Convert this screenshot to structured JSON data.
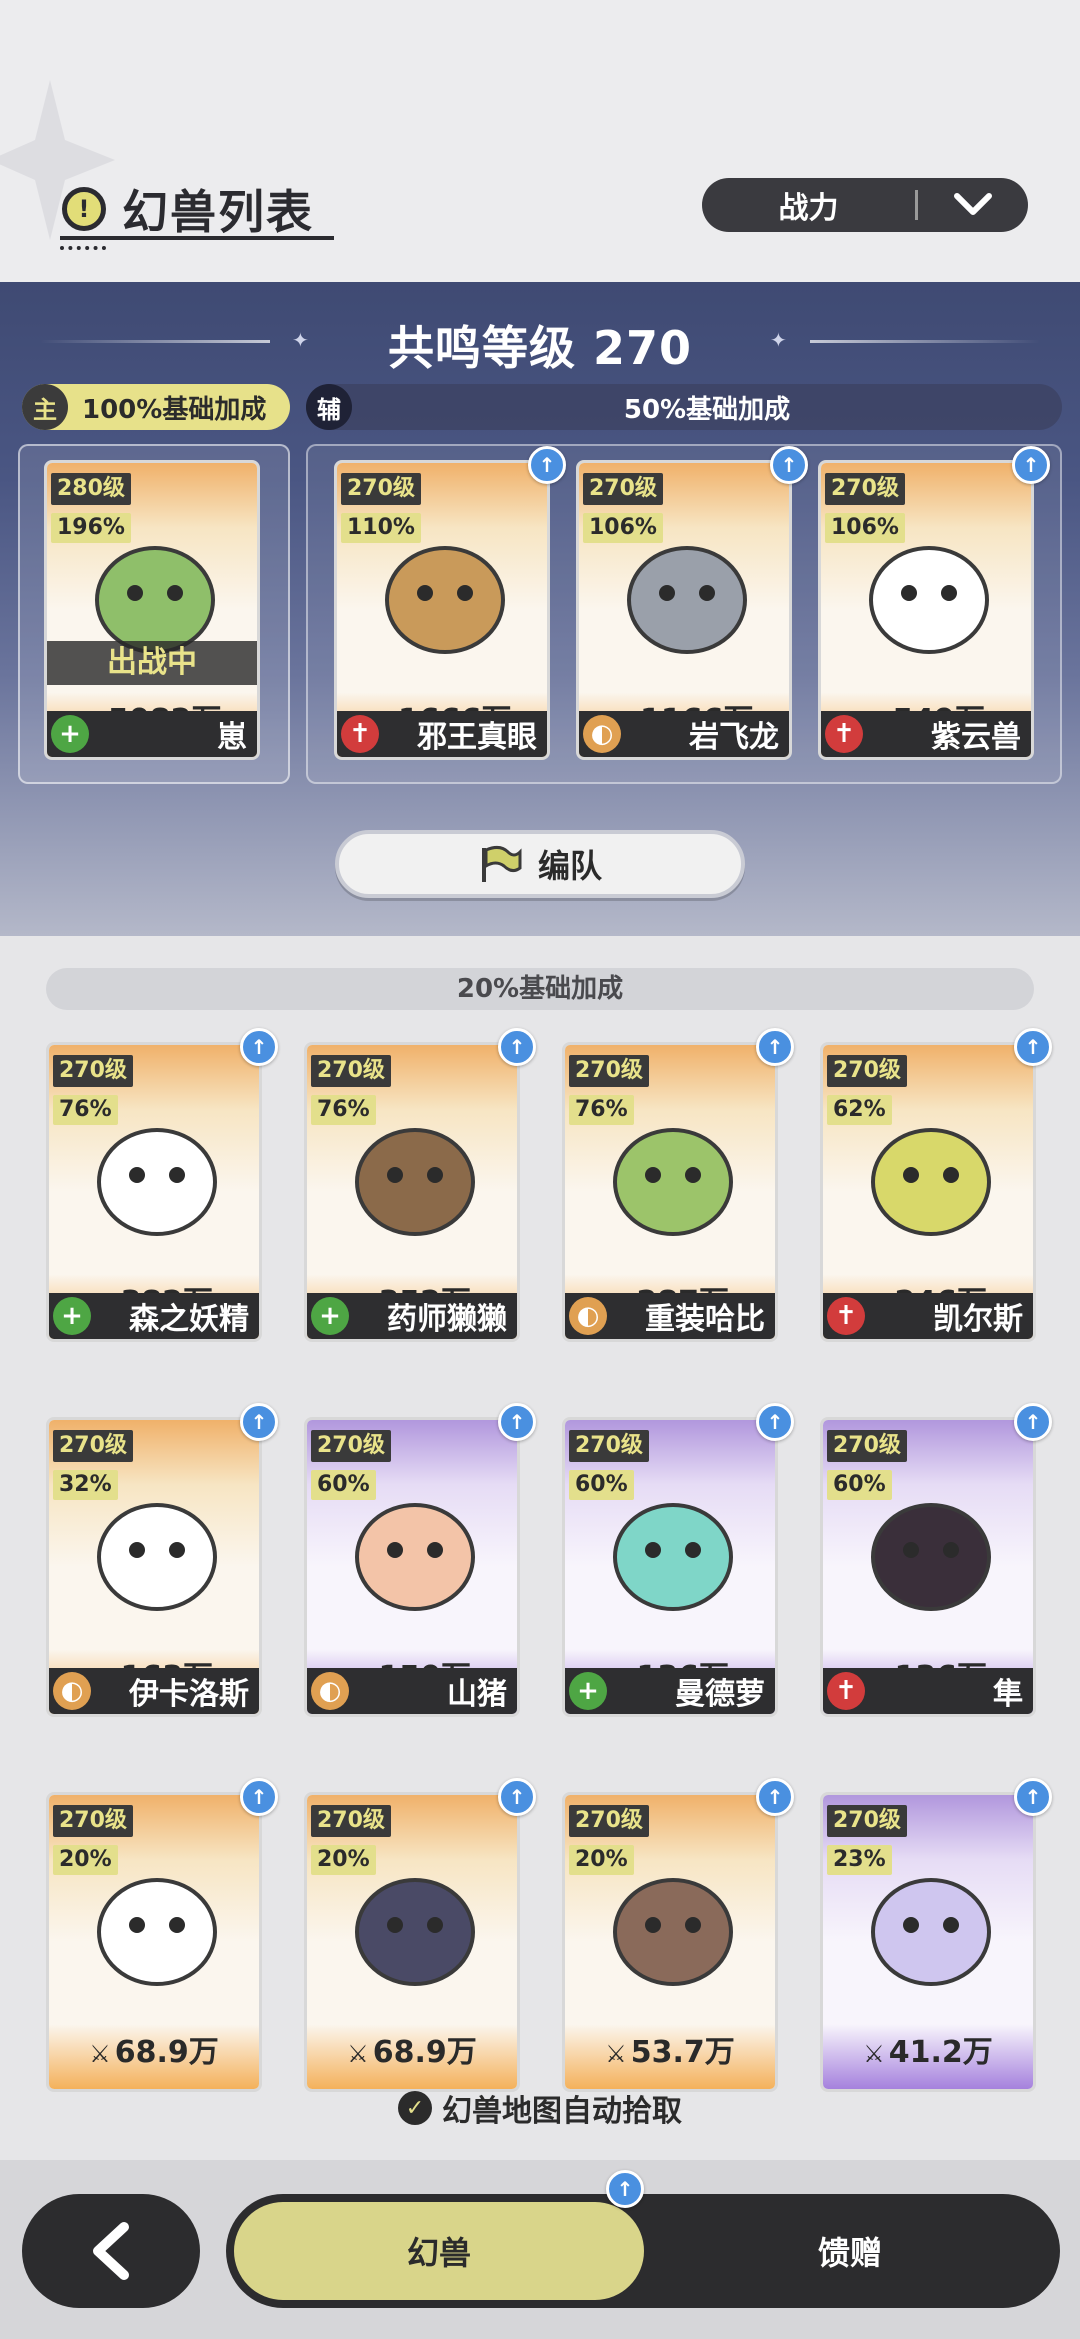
{
  "header": {
    "title": "幻兽列表",
    "sort_label": "战力"
  },
  "resonance": {
    "title": "共鸣等级 270",
    "main_tag": "主",
    "main_bonus": "100%基础加成",
    "sub_tag": "辅",
    "sub_bonus": "50%基础加成",
    "team_button": "编队"
  },
  "main_pet": {
    "level": "280级",
    "pct": "196%",
    "status": "出战中",
    "power": "5082万",
    "name": "崽",
    "role": "heal",
    "frame": "orange"
  },
  "sub_pets": [
    {
      "level": "270级",
      "pct": "110%",
      "power": "1666万",
      "name": "邪王真眼",
      "role": "atk",
      "frame": "orange"
    },
    {
      "level": "270级",
      "pct": "106%",
      "power": "1166万",
      "name": "岩飞龙",
      "role": "def",
      "frame": "orange"
    },
    {
      "level": "270级",
      "pct": "106%",
      "power": "549万",
      "name": "紫云兽",
      "role": "atk",
      "frame": "orange"
    }
  ],
  "list": {
    "bonus": "20%基础加成",
    "pets": [
      {
        "level": "270级",
        "pct": "76%",
        "power": "382万",
        "name": "森之妖精",
        "role": "heal",
        "frame": "orange"
      },
      {
        "level": "270级",
        "pct": "76%",
        "power": "352万",
        "name": "药师獭獭",
        "role": "heal",
        "frame": "orange"
      },
      {
        "level": "270级",
        "pct": "76%",
        "power": "287万",
        "name": "重装哈比",
        "role": "def",
        "frame": "orange"
      },
      {
        "level": "270级",
        "pct": "62%",
        "power": "246万",
        "name": "凯尔斯",
        "role": "atk",
        "frame": "orange"
      },
      {
        "level": "270级",
        "pct": "32%",
        "power": "163万",
        "name": "伊卡洛斯",
        "role": "def",
        "frame": "orange"
      },
      {
        "level": "270级",
        "pct": "60%",
        "power": "150万",
        "name": "山猪",
        "role": "def",
        "frame": "purple"
      },
      {
        "level": "270级",
        "pct": "60%",
        "power": "136万",
        "name": "曼德萝",
        "role": "heal",
        "frame": "purple"
      },
      {
        "level": "270级",
        "pct": "60%",
        "power": "136万",
        "name": "隼",
        "role": "atk",
        "frame": "purple"
      },
      {
        "level": "270级",
        "pct": "20%",
        "power": "68.9万",
        "name": "",
        "role": "",
        "frame": "orange"
      },
      {
        "level": "270级",
        "pct": "20%",
        "power": "68.9万",
        "name": "",
        "role": "",
        "frame": "orange"
      },
      {
        "level": "270级",
        "pct": "20%",
        "power": "53.7万",
        "name": "",
        "role": "",
        "frame": "orange"
      },
      {
        "level": "270级",
        "pct": "23%",
        "power": "41.2万",
        "name": "",
        "role": "",
        "frame": "purple"
      }
    ]
  },
  "auto_pick": "幻兽地图自动拾取",
  "nav": {
    "active": "幻兽",
    "other": "馈赠"
  },
  "colors": {
    "accent": "#e3df8c",
    "dark": "#2e2e30",
    "upgrade": "#4a90e0",
    "heal": "#4ea644",
    "defense": "#e0a052",
    "attack": "#d23c3c"
  }
}
